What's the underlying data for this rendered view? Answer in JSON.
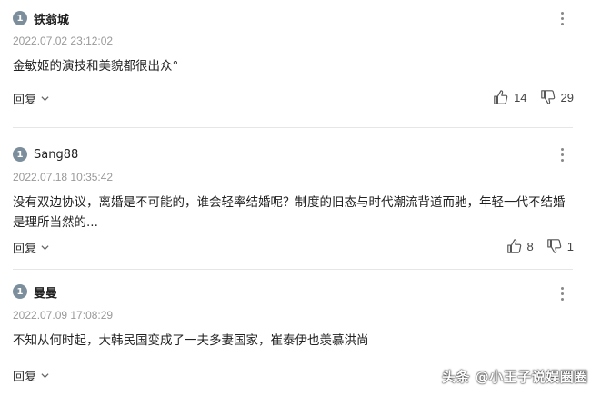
{
  "comments": [
    {
      "rank": "1",
      "author": "铁翁城",
      "timestamp": "2022.07.02 23:12:02",
      "text": "金敏姬的演技和美貌都很出众°",
      "reply_label": "回复",
      "likes": "14",
      "dislikes": "29"
    },
    {
      "rank": "1",
      "author": "Sang88",
      "timestamp": "2022.07.18 10:35:42",
      "text": "没有双边协议，离婚是不可能的，谁会轻率结婚呢？制度的旧态与时代潮流背道而驰，年轻一代不结婚是理所当然的...",
      "reply_label": "回复",
      "likes": "8",
      "dislikes": "1"
    },
    {
      "rank": "1",
      "author": "曼曼",
      "timestamp": "2022.07.09 17:08:29",
      "text": "不知从何时起，大韩民国变成了一夫多妻国家，崔泰伊也羡慕洪尚",
      "reply_label": "回复"
    }
  ],
  "watermark": "头条 @小王子说娱圈圈",
  "colors": {
    "badge": "#7c8e9c",
    "divider": "#e6e6e6",
    "timestamp": "#999999"
  }
}
